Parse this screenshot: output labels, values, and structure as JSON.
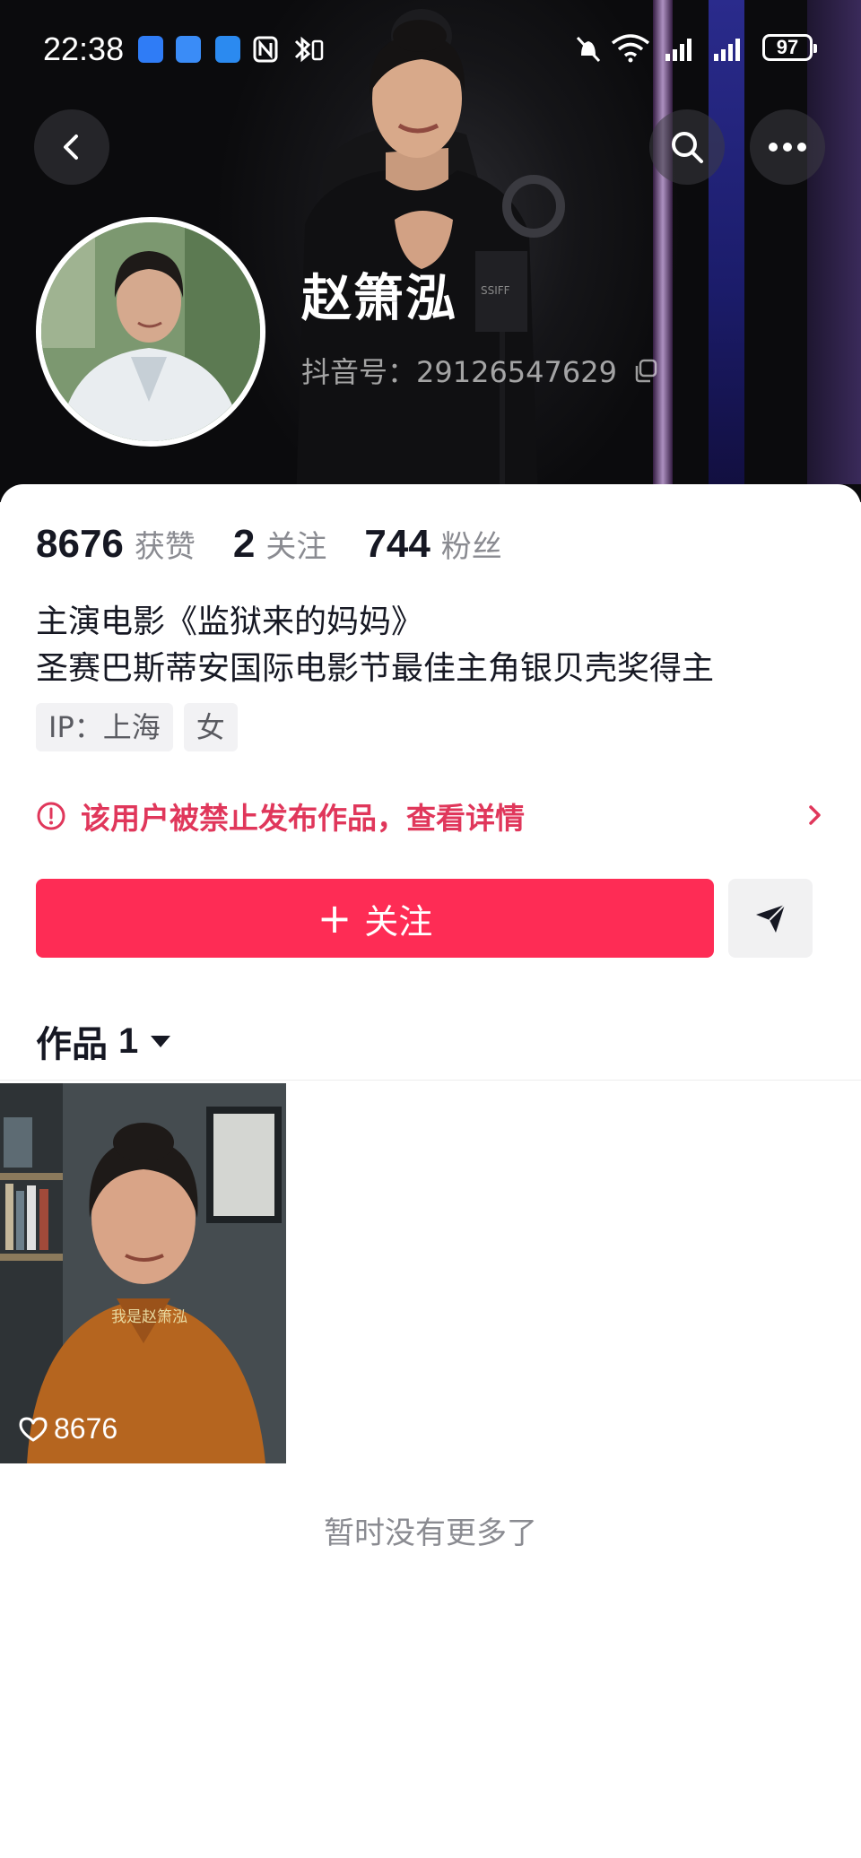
{
  "status_bar": {
    "time": "22:38",
    "battery": "97"
  },
  "profile": {
    "display_name": "赵箫泓",
    "douyin_id": "抖音号：29126547629"
  },
  "stats": {
    "likes_value": "8676",
    "likes_label": "获赞",
    "following_value": "2",
    "following_label": "关注",
    "followers_value": "744",
    "followers_label": "粉丝"
  },
  "bio": {
    "line1": "主演电影《监狱来的妈妈》",
    "line2": "圣赛巴斯蒂安国际电影节最佳主角银贝壳奖得主"
  },
  "tags": [
    "IP：上海",
    "女"
  ],
  "notice": {
    "text": "该用户被禁止发布作品，查看详情",
    "color": "#e0375b"
  },
  "actions": {
    "follow_label": "关注",
    "follow_color": "#fe2c55"
  },
  "works": {
    "label": "作品",
    "count": "1",
    "videos": [
      {
        "likes": "8676",
        "caption": "我是赵箫泓"
      }
    ]
  },
  "footer": {
    "no_more": "暂时没有更多了"
  },
  "icons": {
    "back": "chevron-left-icon",
    "search": "search-icon",
    "more": "more-dots-icon",
    "share": "share-arrow-icon"
  }
}
